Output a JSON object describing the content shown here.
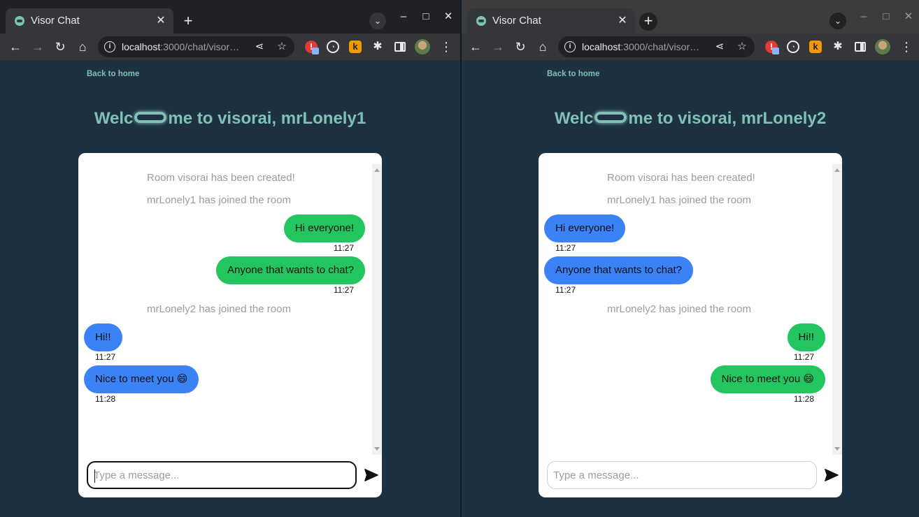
{
  "browser": {
    "tab_title": "Visor Chat",
    "url_host": "localhost",
    "url_rest": ":3000/chat/visor…",
    "window_controls": {
      "minimize": "–",
      "maximize": "□",
      "close": "✕"
    }
  },
  "page": {
    "back_link": "Back to home",
    "welcome_prefix": "Welc",
    "welcome_suffix": "me to visorai, ",
    "input_placeholder": "Type a message...",
    "send_icon": "send-icon",
    "colors": {
      "background": "#1e3141",
      "accent": "#7fc1b6",
      "own_bubble": "#22c55e",
      "other_bubble": "#3b82f6",
      "system_text": "#9b9ba6"
    }
  },
  "windows": [
    {
      "username": "mrLonely1",
      "system_messages": [
        "Room visorai has been created!",
        "mrLonely1 has joined the room",
        "mrLonely2 has joined the room"
      ],
      "messages": [
        {
          "text": "Hi everyone!",
          "time": "11:27",
          "own": true
        },
        {
          "text": "Anyone that wants to chat?",
          "time": "11:27",
          "own": true
        },
        {
          "text": "Hi!!",
          "time": "11:27",
          "own": false
        },
        {
          "text": "Nice to meet you 😄",
          "time": "11:28",
          "own": false
        }
      ]
    },
    {
      "username": "mrLonely2",
      "system_messages": [
        "Room visorai has been created!",
        "mrLonely1 has joined the room",
        "mrLonely2 has joined the room"
      ],
      "messages": [
        {
          "text": "Hi everyone!",
          "time": "11:27",
          "own": false
        },
        {
          "text": "Anyone that wants to chat?",
          "time": "11:27",
          "own": false
        },
        {
          "text": "Hi!!",
          "time": "11:27",
          "own": true
        },
        {
          "text": "Nice to meet you 😄",
          "time": "11:28",
          "own": true
        }
      ]
    }
  ]
}
